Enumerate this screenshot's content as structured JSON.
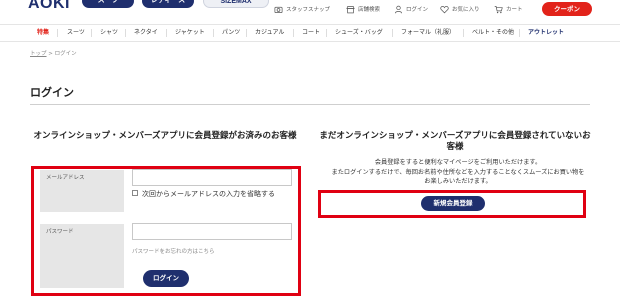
{
  "header": {
    "logo": "AOKI",
    "brand_tabs": [
      "スーツ",
      "レディース",
      "SIZEMAX"
    ],
    "utility": {
      "staff_snap": "スタッフスナップ",
      "store_search": "店舗検索",
      "login": "ログイン",
      "favorites": "お気に入り",
      "cart": "カート"
    },
    "coupon_label": "クーポン"
  },
  "category_nav": {
    "items": [
      "特集",
      "スーツ",
      "シャツ",
      "ネクタイ",
      "ジャケット",
      "パンツ",
      "カジュアル",
      "コート",
      "シューズ・バッグ",
      "フォーマル（礼服）",
      "ベルト・その他",
      "アウトレット"
    ]
  },
  "breadcrumb": {
    "home": "トップ",
    "separator": " > ",
    "current": "ログイン"
  },
  "page_title": "ログイン",
  "member_section": {
    "heading": "オンラインショップ・メンバーズアプリに会員登録がお済みのお客様",
    "email_label": "メールアドレス",
    "email_value": "",
    "remember_label": "次回からメールアドレスの入力を省略する",
    "remember_checked": false,
    "password_label": "パスワード",
    "password_value": "",
    "forgot_link": "パスワードをお忘れの方はこちら",
    "login_button": "ログイン"
  },
  "guest_section": {
    "heading": "まだオンラインショップ・メンバーズアプリに会員登録されていないお客様",
    "description_1": "会員登録をすると便利なマイページをご利用いただけます。",
    "description_2": "またログインするだけで、毎回お名前や住所などを入力することなくスムーズにお買い物をお楽しみいただけます。",
    "register_button": "新規会員登録"
  },
  "colors": {
    "brand_navy": "#1f2f6e",
    "coupon_red": "#e2231a",
    "highlight_red": "#e00012"
  }
}
